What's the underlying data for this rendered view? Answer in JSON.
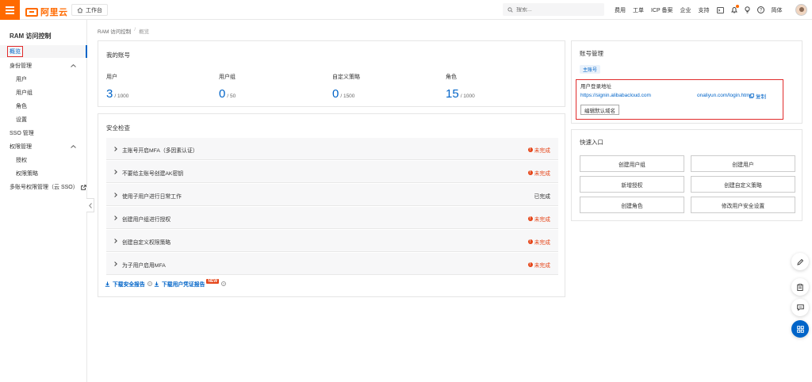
{
  "topbar": {
    "logo_text": "阿里云",
    "workbench_label": "工作台",
    "search_placeholder": "搜索...",
    "nav_items": [
      "费用",
      "工单",
      "ICP 备案",
      "企业",
      "支持"
    ],
    "lang_label": "简体",
    "accent_color": "#ff6a00"
  },
  "sidebar": {
    "title": "RAM 访问控制",
    "items": [
      {
        "label": "概览",
        "active": true
      },
      {
        "label": "身份管理",
        "group": true
      },
      {
        "label": "用户"
      },
      {
        "label": "用户组"
      },
      {
        "label": "角色"
      },
      {
        "label": "设置"
      },
      {
        "label": "SSO 管理"
      },
      {
        "label": "权限管理",
        "group": true
      },
      {
        "label": "授权"
      },
      {
        "label": "权限策略"
      },
      {
        "label": "多账号权限管理（云 SSO）",
        "external": true
      }
    ]
  },
  "breadcrumb": [
    "RAM 访问控制",
    "概览"
  ],
  "account": {
    "title": "我的账号",
    "stats": [
      {
        "label": "用户",
        "value": "3",
        "limit": "/ 1000"
      },
      {
        "label": "用户组",
        "value": "0",
        "limit": "/ 50"
      },
      {
        "label": "自定义策略",
        "value": "0",
        "limit": "/ 1500"
      },
      {
        "label": "角色",
        "value": "15",
        "limit": "/ 1000"
      }
    ]
  },
  "security": {
    "title": "安全检查",
    "items": [
      {
        "text": "主账号开启MFA（多因素认证）",
        "status": "未完成",
        "warn": true
      },
      {
        "text": "不要给主账号创建AK密钥",
        "status": "未完成",
        "warn": true
      },
      {
        "text": "使用子用户进行日常工作",
        "status": "已完成",
        "warn": false
      },
      {
        "text": "创建用户组进行授权",
        "status": "未完成",
        "warn": true
      },
      {
        "text": "创建自定义权限策略",
        "status": "未完成",
        "warn": true
      },
      {
        "text": "为子用户启用MFA",
        "status": "未完成",
        "warn": true
      }
    ],
    "download_report": "下载安全报告",
    "download_cred": "下载用户凭证报告",
    "new_badge": "NEW"
  },
  "account_mgmt": {
    "title": "账号管理",
    "tag": "主账号",
    "login_label": "用户登录地址",
    "login_url_1": "https://signin.alibabacloud.com",
    "login_url_2": "onaliyun.com/login.htm",
    "copy_label": "复制",
    "edit_domain": "编辑默认域名"
  },
  "quick": {
    "title": "快速入口",
    "buttons": [
      "创建用户组",
      "创建用户",
      "新增授权",
      "创建自定义策略",
      "创建角色",
      "修改用户安全设置"
    ]
  }
}
